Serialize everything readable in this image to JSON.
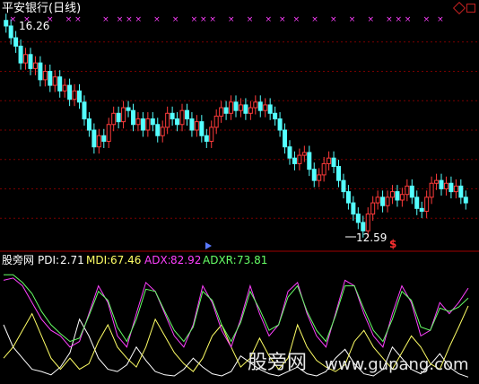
{
  "price_panel": {
    "title": "平安银行(日线)",
    "high_label": "16.26",
    "low_label": "12.59",
    "signal_marker": "$",
    "colors": {
      "up": "#ff3b3b",
      "down": "#54ffff",
      "signal": "#ff40ff",
      "grid": "#7a0000"
    }
  },
  "indicator_panel": {
    "name": "股旁网",
    "pdi_label": "PDI:",
    "pdi_value": "2.71",
    "mdi_label": "MDI:",
    "mdi_value": "67.46",
    "adx_label": "ADX:",
    "adx_value": "82.92",
    "adxr_label": "ADXR:",
    "adxr_value": "73.81",
    "colors": {
      "pdi": "#ffffff",
      "mdi": "#ffff66",
      "adx": "#ff40ff",
      "adxr": "#66ff66"
    }
  },
  "watermark": {
    "cn": "股旁网",
    "url": "www.gupang.com"
  },
  "chart_data": [
    {
      "type": "candlestick",
      "title": "平安银行(日线)",
      "high_annotation": 16.26,
      "low_annotation": 12.59,
      "ylim": [
        12.3,
        16.5
      ],
      "grid": true,
      "closes": [
        16.26,
        16.05,
        15.9,
        15.6,
        15.75,
        15.5,
        15.6,
        15.3,
        15.45,
        15.2,
        15.35,
        15.1,
        15.2,
        14.95,
        15.1,
        14.9,
        14.6,
        14.4,
        14.1,
        14.3,
        14.2,
        14.5,
        14.7,
        14.55,
        14.8,
        14.75,
        14.5,
        14.6,
        14.4,
        14.6,
        14.5,
        14.3,
        14.45,
        14.7,
        14.6,
        14.5,
        14.75,
        14.6,
        14.4,
        14.55,
        14.3,
        14.2,
        14.45,
        14.65,
        14.8,
        14.7,
        14.9,
        14.75,
        14.85,
        14.7,
        14.8,
        14.9,
        14.75,
        14.85,
        14.7,
        14.6,
        14.4,
        14.1,
        13.9,
        13.8,
        13.95,
        14.0,
        13.7,
        13.5,
        13.6,
        13.8,
        13.9,
        13.75,
        13.5,
        13.3,
        13.1,
        12.9,
        12.75,
        12.6,
        12.9,
        13.1,
        13.2,
        13.05,
        13.2,
        13.3,
        13.15,
        13.25,
        13.4,
        13.2,
        13.0,
        12.95,
        13.2,
        13.45,
        13.5,
        13.35,
        13.45,
        13.3,
        13.4,
        13.2,
        13.1
      ],
      "signal_x": [
        0.02,
        0.05,
        0.1,
        0.14,
        0.16,
        0.22,
        0.25,
        0.27,
        0.29,
        0.33,
        0.37,
        0.41,
        0.43,
        0.45,
        0.49,
        0.53,
        0.57,
        0.6,
        0.63,
        0.67,
        0.71,
        0.75,
        0.79,
        0.83,
        0.85,
        0.87,
        0.91,
        0.94
      ],
      "signal_y": 16.4
    },
    {
      "type": "line",
      "name": "DMI",
      "ylim": [
        0,
        100
      ],
      "series": [
        {
          "name": "PDI",
          "color": "#ffffff",
          "values": [
            50,
            30,
            20,
            10,
            8,
            5,
            12,
            25,
            55,
            40,
            20,
            10,
            8,
            14,
            30,
            18,
            8,
            5,
            4,
            10,
            20,
            12,
            6,
            4,
            8,
            22,
            16,
            10,
            6,
            4,
            8,
            12,
            6,
            4,
            8,
            20,
            28,
            15,
            6,
            4,
            10,
            30,
            20,
            10,
            6,
            14,
            24,
            12,
            6,
            3
          ]
        },
        {
          "name": "MDI",
          "color": "#ffff66",
          "values": [
            20,
            30,
            45,
            60,
            40,
            20,
            10,
            20,
            10,
            15,
            35,
            50,
            30,
            20,
            12,
            30,
            55,
            40,
            25,
            15,
            8,
            20,
            40,
            50,
            30,
            12,
            20,
            38,
            22,
            10,
            20,
            50,
            30,
            18,
            12,
            8,
            14,
            35,
            45,
            30,
            20,
            10,
            25,
            40,
            30,
            15,
            10,
            30,
            48,
            67
          ]
        },
        {
          "name": "ADX",
          "color": "#ff40ff",
          "values": [
            90,
            92,
            85,
            70,
            55,
            45,
            40,
            30,
            35,
            60,
            85,
            70,
            40,
            30,
            60,
            88,
            80,
            60,
            40,
            30,
            50,
            85,
            70,
            45,
            30,
            55,
            85,
            60,
            40,
            50,
            80,
            88,
            60,
            40,
            30,
            60,
            90,
            85,
            60,
            40,
            30,
            60,
            85,
            70,
            40,
            45,
            70,
            60,
            70,
            83
          ]
        },
        {
          "name": "ADXR",
          "color": "#66ff66",
          "values": [
            95,
            95,
            88,
            78,
            62,
            50,
            42,
            35,
            38,
            58,
            80,
            72,
            48,
            35,
            55,
            82,
            80,
            62,
            45,
            35,
            48,
            80,
            72,
            50,
            35,
            52,
            80,
            64,
            45,
            50,
            75,
            85,
            62,
            45,
            35,
            58,
            85,
            85,
            64,
            45,
            35,
            55,
            80,
            72,
            48,
            45,
            65,
            62,
            66,
            74
          ]
        }
      ]
    }
  ]
}
